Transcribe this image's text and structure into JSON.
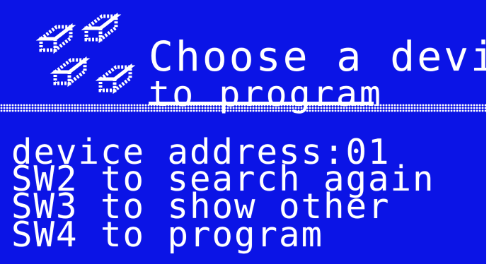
{
  "screen": {
    "title_line1": "Choose a device",
    "title_line2": "to program",
    "icon": "device-chip-icon"
  },
  "info": {
    "address_line": "device address:01",
    "sw2_line": "SW2 to search again",
    "sw3_line": "SW3 to show other",
    "sw4_line": "SW4 to program"
  },
  "colors": {
    "background": "#0b14e6",
    "foreground": "#ffffff"
  }
}
